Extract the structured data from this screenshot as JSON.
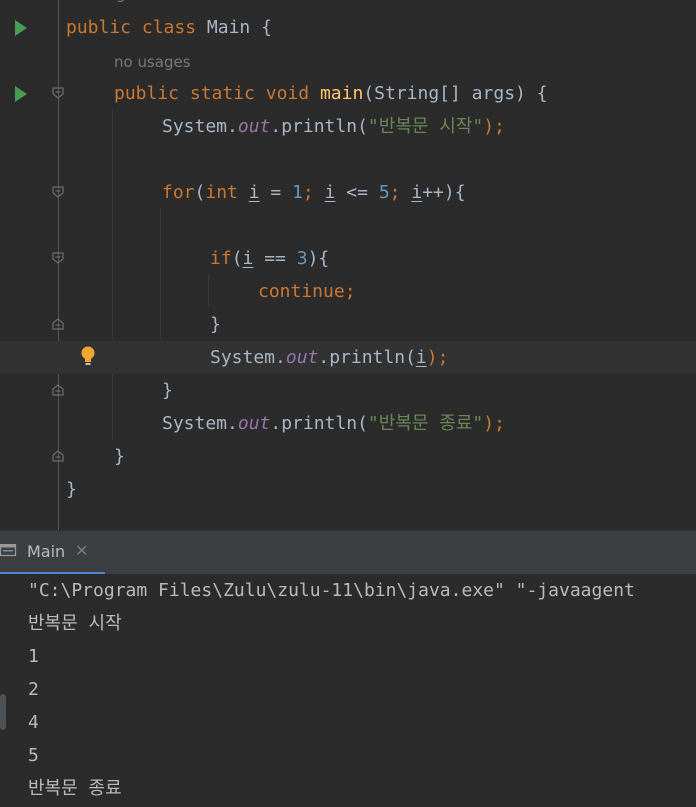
{
  "editor": {
    "hint_top": "no usages",
    "hint_main": "no usages",
    "lines": {
      "class_decl": {
        "kw_public": "public",
        "kw_class": "class",
        "name": "Main",
        "brace": " {"
      },
      "main_decl": {
        "kw_public": "public",
        "kw_static": "static",
        "kw_void": "void",
        "fn": "main",
        "params": "(String[] args) {"
      },
      "print_start": {
        "sys": "System.",
        "field": "out",
        "call": ".println(",
        "str": "\"반복문 시작\"",
        "end": ");"
      },
      "for_loop": {
        "kw": "for",
        "open": "(",
        "kw_int": "int",
        "var1": "i",
        "eq": " = ",
        "n1": "1",
        "semi1": "; ",
        "var2": "i",
        "le": " <= ",
        "n5": "5",
        "semi2": "; ",
        "var3": "i",
        "inc": "++){"
      },
      "if_stmt": {
        "kw": "if",
        "open": "(",
        "var": "i",
        "eqeq": " == ",
        "n3": "3",
        "close": "){"
      },
      "continue_stmt": {
        "kw": "continue;"
      },
      "close_if": "}",
      "print_i": {
        "sys": "System.",
        "field": "out",
        "call": ".println(",
        "var": "i",
        "end": ");"
      },
      "close_for": "}",
      "print_end": {
        "sys": "System.",
        "field": "out",
        "call": ".println(",
        "str": "\"반복문 종료\"",
        "end": ");"
      },
      "close_main": "}",
      "close_class": "}"
    }
  },
  "run_tool": {
    "tab_label": "Main",
    "close_glyph": "✕"
  },
  "console": {
    "lines": [
      "\"C:\\Program Files\\Zulu\\zulu-11\\bin\\java.exe\" \"-javaagent",
      "반복문 시작",
      "1",
      "2",
      "4",
      "5",
      "반복문 종료"
    ]
  },
  "colors": {
    "keyword": "#cc7832",
    "function": "#ffc66d",
    "string": "#6a8759",
    "number": "#6897bb",
    "field": "#9876aa",
    "run": "#499c54"
  }
}
